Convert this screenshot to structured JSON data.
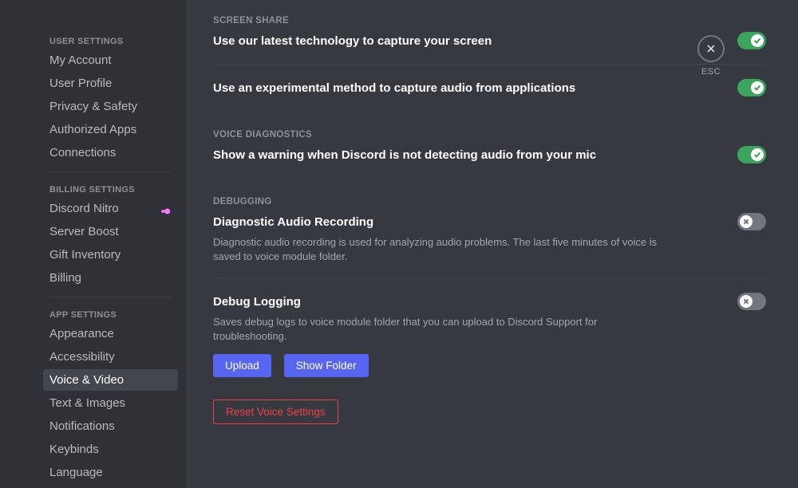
{
  "sidebar": {
    "sections": [
      {
        "header": "USER SETTINGS",
        "items": [
          {
            "label": "My Account",
            "name": "my-account"
          },
          {
            "label": "User Profile",
            "name": "user-profile"
          },
          {
            "label": "Privacy & Safety",
            "name": "privacy-safety"
          },
          {
            "label": "Authorized Apps",
            "name": "authorized-apps"
          },
          {
            "label": "Connections",
            "name": "connections"
          }
        ]
      },
      {
        "header": "BILLING SETTINGS",
        "items": [
          {
            "label": "Discord Nitro",
            "name": "discord-nitro",
            "badge": true
          },
          {
            "label": "Server Boost",
            "name": "server-boost"
          },
          {
            "label": "Gift Inventory",
            "name": "gift-inventory"
          },
          {
            "label": "Billing",
            "name": "billing"
          }
        ]
      },
      {
        "header": "APP SETTINGS",
        "items": [
          {
            "label": "Appearance",
            "name": "appearance"
          },
          {
            "label": "Accessibility",
            "name": "accessibility"
          },
          {
            "label": "Voice & Video",
            "name": "voice-video",
            "selected": true
          },
          {
            "label": "Text & Images",
            "name": "text-images"
          },
          {
            "label": "Notifications",
            "name": "notifications"
          },
          {
            "label": "Keybinds",
            "name": "keybinds"
          },
          {
            "label": "Language",
            "name": "language"
          }
        ]
      }
    ]
  },
  "close": {
    "label": "ESC"
  },
  "sections": {
    "screenShare": {
      "header": "SCREEN SHARE",
      "opt1": {
        "title": "Use our latest technology to capture your screen",
        "on": true
      },
      "opt2": {
        "title": "Use an experimental method to capture audio from applications",
        "on": true
      }
    },
    "voiceDiag": {
      "header": "VOICE DIAGNOSTICS",
      "opt1": {
        "title": "Show a warning when Discord is not detecting audio from your mic",
        "on": true
      }
    },
    "debugging": {
      "header": "DEBUGGING",
      "diagAudio": {
        "title": "Diagnostic Audio Recording",
        "desc": "Diagnostic audio recording is used for analyzing audio problems. The last five minutes of voice is saved to voice module folder.",
        "on": false
      },
      "debugLog": {
        "title": "Debug Logging",
        "desc": "Saves debug logs to voice module folder that you can upload to Discord Support for troubleshooting.",
        "on": false
      },
      "uploadBtn": "Upload",
      "showFolderBtn": "Show Folder"
    },
    "resetBtn": "Reset Voice Settings"
  }
}
